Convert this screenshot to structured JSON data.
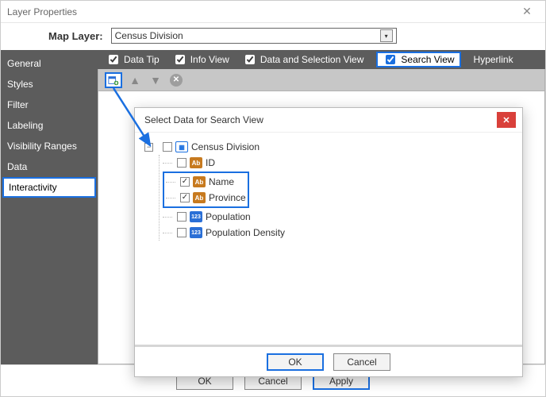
{
  "window": {
    "title": "Layer Properties"
  },
  "mapLayer": {
    "label": "Map Layer:",
    "value": "Census Division"
  },
  "sidebar": {
    "items": [
      {
        "label": "General"
      },
      {
        "label": "Styles"
      },
      {
        "label": "Filter"
      },
      {
        "label": "Labeling"
      },
      {
        "label": "Visibility Ranges"
      },
      {
        "label": "Data"
      },
      {
        "label": "Interactivity"
      }
    ],
    "selectedIndex": 6
  },
  "tabs": {
    "dataTip": {
      "label": "Data Tip",
      "checked": true
    },
    "infoView": {
      "label": "Info View",
      "checked": true
    },
    "dataSel": {
      "label": "Data and Selection View",
      "checked": true
    },
    "searchView": {
      "label": "Search View",
      "checked": true
    },
    "hyperlink": {
      "label": "Hyperlink"
    }
  },
  "modal": {
    "title": "Select Data for Search View",
    "root": {
      "label": "Census Division",
      "checked": false,
      "type": "table"
    },
    "fields": [
      {
        "label": "ID",
        "checked": false,
        "type": "ab",
        "highlight": false
      },
      {
        "label": "Name",
        "checked": true,
        "type": "ab",
        "highlight": true
      },
      {
        "label": "Province",
        "checked": true,
        "type": "ab",
        "highlight": true
      },
      {
        "label": "Population",
        "checked": false,
        "type": "123",
        "highlight": false
      },
      {
        "label": "Population Density",
        "checked": false,
        "type": "123",
        "highlight": false
      }
    ],
    "buttons": {
      "ok": "OK",
      "cancel": "Cancel"
    }
  },
  "mainButtons": {
    "ok": "OK",
    "cancel": "Cancel",
    "apply": "Apply"
  }
}
